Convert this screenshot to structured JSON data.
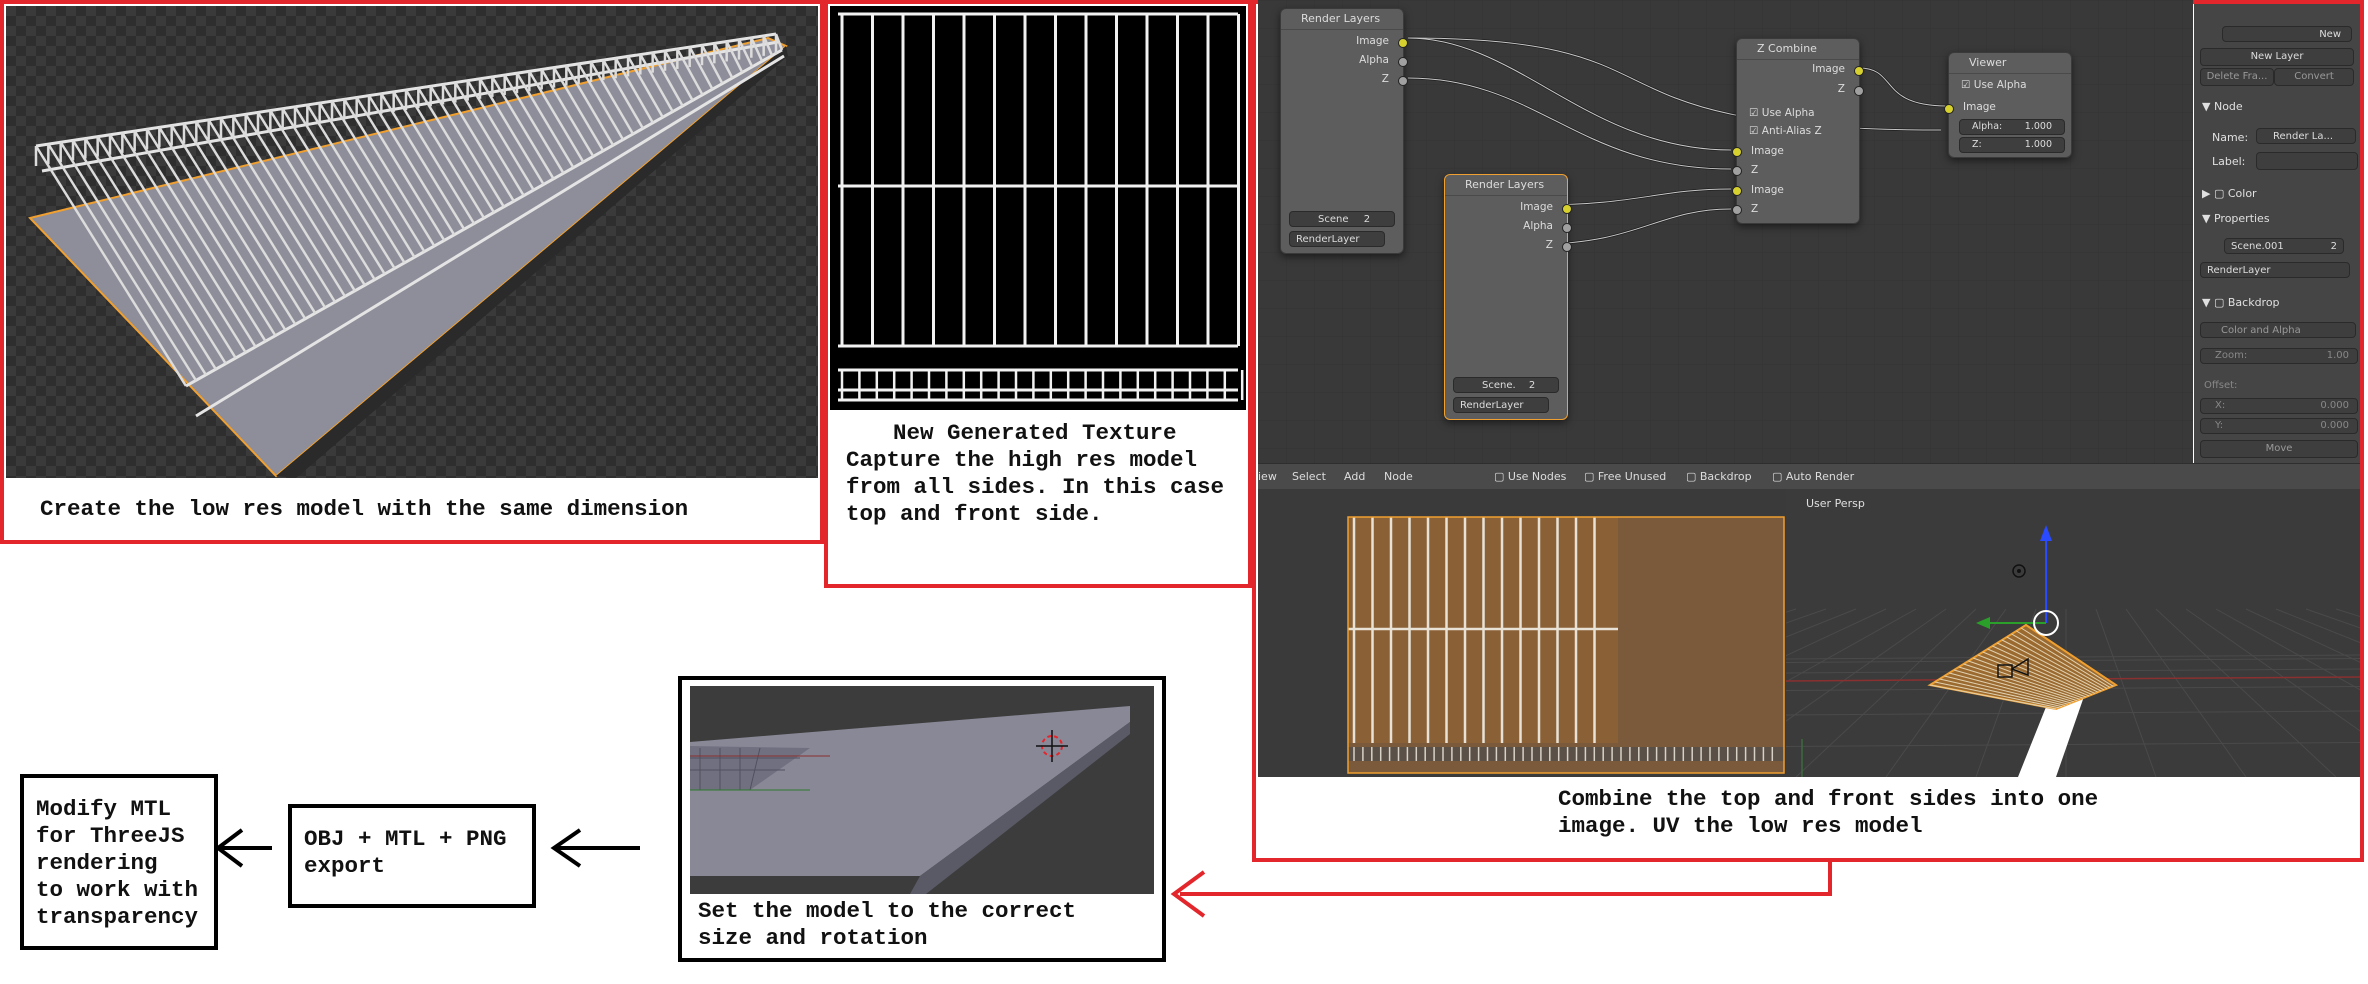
{
  "captions": {
    "low_res": "Create the low res model with the same dimension",
    "texture_title": "New Generated Texture",
    "texture_body": [
      "Capture the high res model",
      "from all sides. In this case",
      "top and front side."
    ],
    "combine": [
      "Combine the top and front sides into one",
      "image. UV the low res model"
    ],
    "set_model": [
      "Set the model to the correct",
      "size and rotation"
    ],
    "export": [
      "OBJ + MTL + PNG",
      "export"
    ],
    "modify": [
      "Modify MTL",
      "for ThreeJS",
      "rendering",
      "to work with",
      "transparency"
    ]
  },
  "nodes": {
    "render_layers_1": {
      "title": "Render Layers",
      "outputs": [
        "Image",
        "Alpha",
        "Z"
      ],
      "scene": "Scene",
      "scene_users": "2",
      "layer": "RenderLayer"
    },
    "render_layers_2": {
      "title": "Render Layers",
      "outputs": [
        "Image",
        "Alpha",
        "Z"
      ],
      "scene": "Scene.",
      "scene_users": "2",
      "layer": "RenderLayer"
    },
    "z_combine": {
      "title": "Z Combine",
      "outputs": [
        "Image",
        "Z"
      ],
      "options": [
        "Use Alpha",
        "Anti-Alias Z"
      ],
      "inputs": [
        "Image",
        "Z",
        "Image",
        "Z"
      ]
    },
    "viewer": {
      "title": "Viewer",
      "option": "Use Alpha",
      "input": "Image",
      "alpha_label": "Alpha:",
      "alpha_value": "1.000",
      "z_label": "Z:",
      "z_value": "1.000"
    }
  },
  "node_header": {
    "menu": [
      "iew",
      "Select",
      "Add",
      "Node"
    ],
    "checks": [
      "Use Nodes",
      "Free Unused",
      "Backdrop",
      "Auto Render"
    ]
  },
  "properties_panel": {
    "new_button": "New",
    "new_layer": "New Layer",
    "delete_frame": "Delete Fra...",
    "convert": "Convert",
    "node_section": "Node",
    "name_label": "Name:",
    "name_value": "Render La...",
    "label_label": "Label:",
    "color_section": "Color",
    "properties_section": "Properties",
    "scene_value": "Scene.001",
    "scene_users": "2",
    "layer_value": "RenderLayer",
    "backdrop_section": "Backdrop",
    "color_alpha": "Color and Alpha",
    "zoom_label": "Zoom:",
    "zoom_value": "1.00",
    "offset_label": "Offset:",
    "x_label": "X:",
    "x_value": "0.000",
    "y_label": "Y:",
    "y_value": "0.000",
    "move_button": "Move"
  },
  "viewport": {
    "label": "User Persp"
  },
  "colors": {
    "red": "#e3262b",
    "blender_bg": "#393939",
    "node_bg": "#5d5d5d",
    "socket_yellow": "#d6d12e",
    "selected_orange": "#f0a030"
  },
  "icons": [
    "left-arrow-icon",
    "3d-cursor-icon",
    "camera-icon",
    "lamp-icon",
    "transform-gizmo-icon"
  ]
}
